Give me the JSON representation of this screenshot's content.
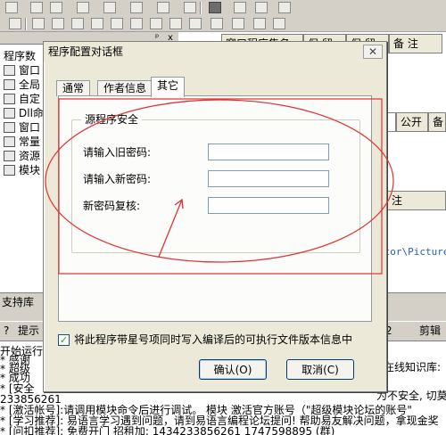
{
  "background": {
    "left_panel": {
      "header_label": "程序数",
      "pin_glyph": "ᵖ",
      "close_glyph": "x",
      "items": [
        "窗口",
        "全局",
        "自定",
        "Dll命",
        "窗口",
        "常量",
        "资源",
        "模块"
      ]
    },
    "grid": {
      "header_row": [
        "窗口程序集名",
        "保 留",
        "保 留",
        "备 注"
      ],
      "row2_label": "型",
      "row2_cols": [
        "公开",
        "备"
      ],
      "row3_label": "注",
      "path_fragment": "ator\\Picture"
    },
    "bottom_tab_left": "支持库",
    "bottom_tabs": {
      "left_icon": "?",
      "left_label": "提示",
      "right1": "2",
      "right2": "剪辑"
    },
    "output_lines": [
      "开始运行",
      "* 感谢",
      "* 超级",
      "* 成功",
      "* [安全",
      "233856261",
      "* [激活帐号]:请调用模块命令后进行调试。        模块 激活官方账号（\"超级模块论坛的账号\"",
      "* [学习推荐]: 易语言学习遇到问题，请到易语言编程论坛提问! 帮助易友解决问题，拿现金奖",
      "* [问扣推荐]: 免费开门 招租加: 1434233856261 1747598895 (群)"
    ],
    "output_right_1": "在线知识库:",
    "output_right_2": "为不安全, 切莫"
  },
  "dialog": {
    "title": "程序配置对话框",
    "close_glyph": "✕",
    "tabs": [
      {
        "label": "通常",
        "active": false
      },
      {
        "label": "作者信息",
        "active": false
      },
      {
        "label": "其它",
        "active": true
      }
    ],
    "group_title": "源程序安全",
    "fields": [
      {
        "label": "请输入旧密码:",
        "value": ""
      },
      {
        "label": "请输入新密码:",
        "value": ""
      },
      {
        "label": "新密码复核:",
        "value": ""
      }
    ],
    "checkbox": {
      "checked": true,
      "label": "将此程序带星号项同时写入编译后的可执行文件版本信息中"
    },
    "ok_label": "确认(O)",
    "cancel_label": "取消(C)"
  },
  "annotation": {
    "color": "#e23030"
  }
}
